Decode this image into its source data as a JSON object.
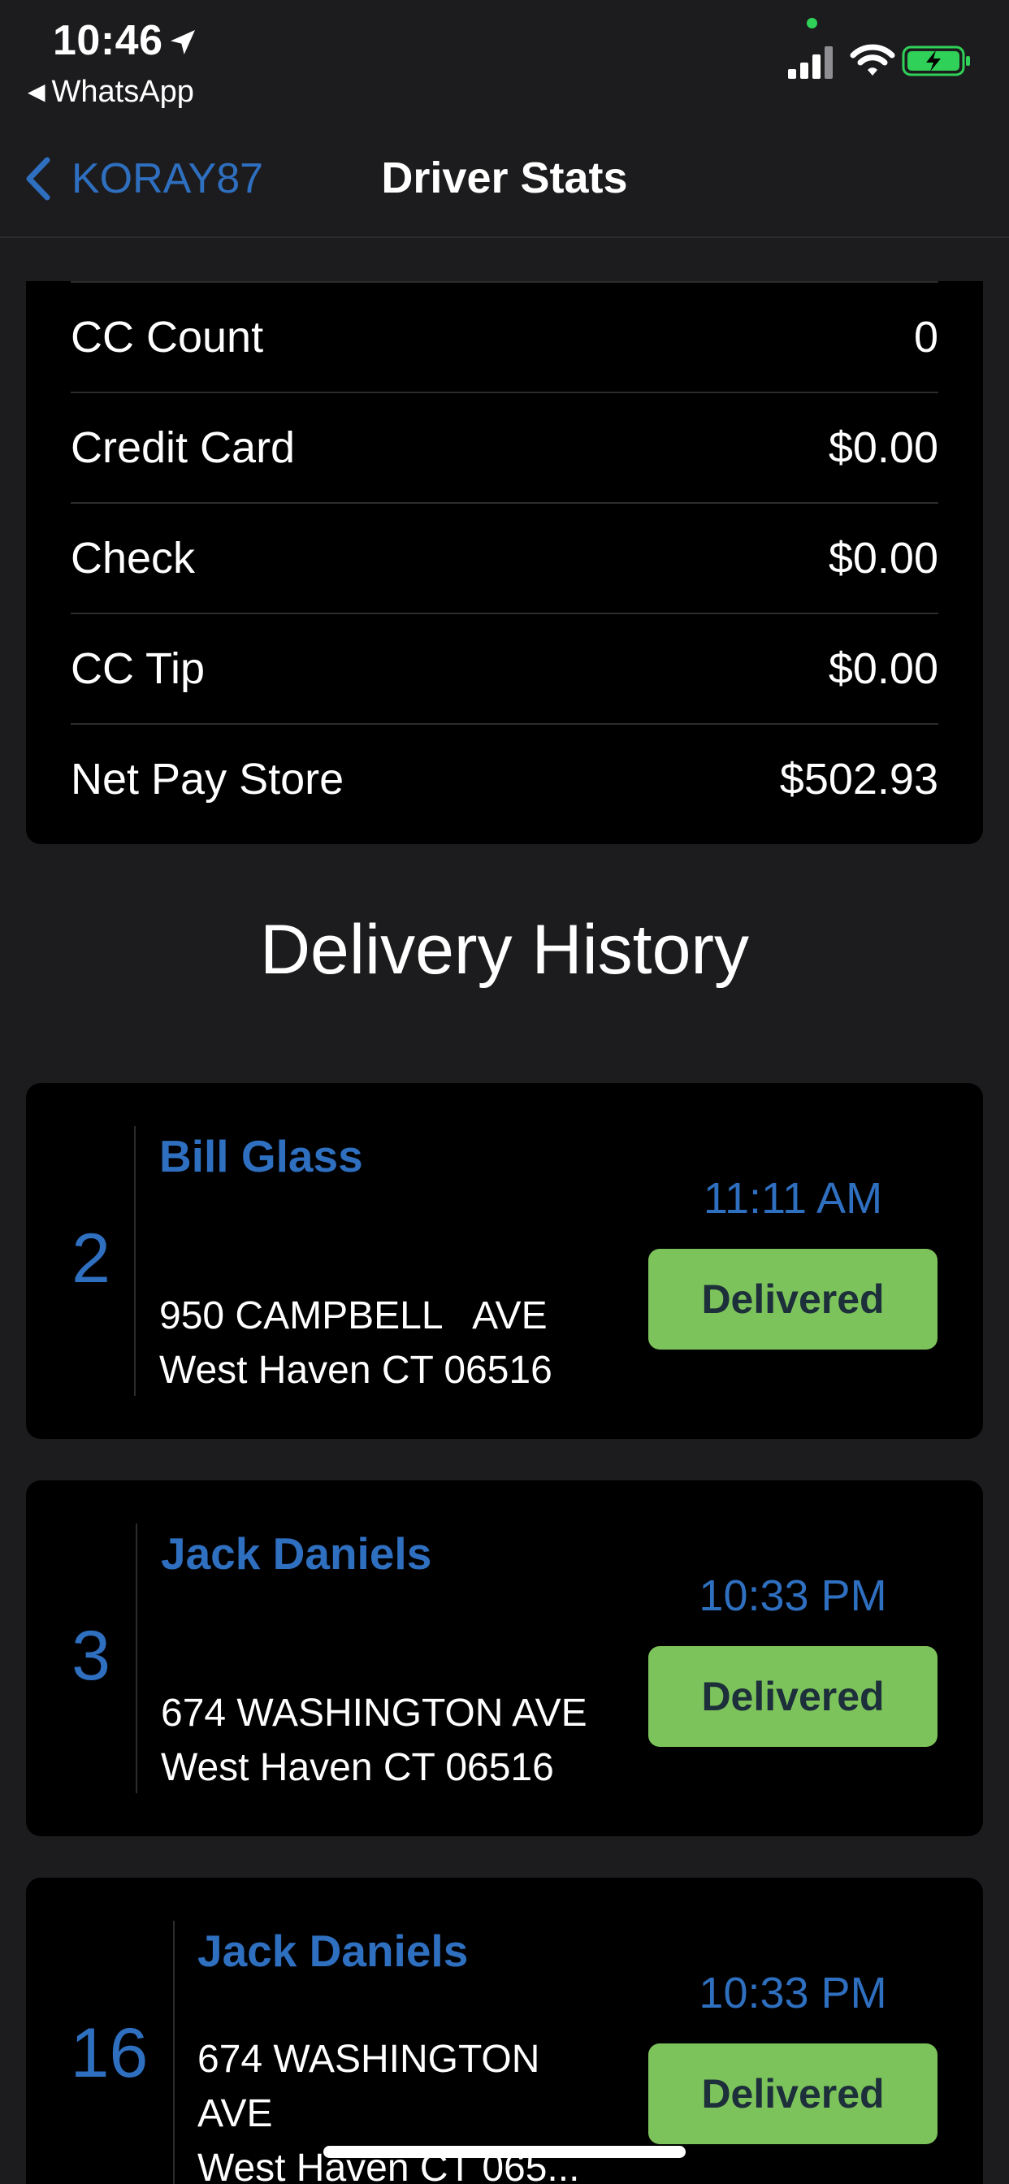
{
  "status_bar": {
    "time": "10:46",
    "back_app": "WhatsApp",
    "location_icon": "location-arrow-icon",
    "signal_icon": "cellular-signal-icon",
    "wifi_icon": "wifi-icon",
    "battery_icon": "battery-charging-icon",
    "battery_color": "#30d158"
  },
  "nav": {
    "back_label": "KORAY87",
    "title": "Driver Stats",
    "accent": "#2f6fc0"
  },
  "stats": {
    "rows": [
      {
        "label": "CC Count",
        "value": "0"
      },
      {
        "label": "Credit Card",
        "value": "$0.00"
      },
      {
        "label": "Check",
        "value": "$0.00"
      },
      {
        "label": "CC Tip",
        "value": "$0.00"
      },
      {
        "label": "Net Pay Store",
        "value": "$502.93"
      }
    ]
  },
  "history": {
    "title": "Delivery History",
    "items": [
      {
        "number": "2",
        "name": "Bill Glass",
        "address": "950 CAMPBELL   AVE\nWest Haven CT 06516",
        "time": "11:11 AM",
        "status": "Delivered"
      },
      {
        "number": "3",
        "name": "Jack Daniels",
        "address": "674 WASHINGTON AVE\nWest Haven CT 06516",
        "time": "10:33 PM",
        "status": "Delivered"
      },
      {
        "number": "16",
        "name": "Jack Daniels",
        "address": "674 WASHINGTON\nAVE\nWest Haven CT 065...",
        "time": "10:33 PM",
        "status": "Delivered"
      }
    ],
    "status_color": "#7dc35b"
  }
}
